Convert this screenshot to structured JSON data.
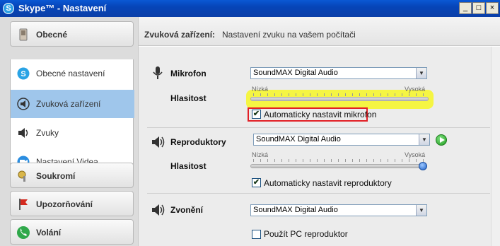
{
  "window": {
    "title": "Skype™ - Nastavení",
    "app_icon_glyph": "S"
  },
  "controls": {
    "minimize": "_",
    "maximize": "□",
    "close": "×"
  },
  "sidebar": {
    "categories": [
      {
        "label": "Obecné",
        "icon": "settings-switch-icon"
      },
      {
        "label": "Soukromí",
        "icon": "lock-key-icon"
      },
      {
        "label": "Upozorňování",
        "icon": "flag-icon"
      },
      {
        "label": "Volání",
        "icon": "phone-icon"
      }
    ],
    "items": [
      {
        "label": "Obecné nastavení",
        "icon": "skype-logo-icon"
      },
      {
        "label": "Zvuková zařízení",
        "icon": "audio-device-icon",
        "active": true
      },
      {
        "label": "Zvuky",
        "icon": "speaker-icon"
      },
      {
        "label": "Nastavení Videa",
        "icon": "video-camera-icon"
      }
    ]
  },
  "header": {
    "title": "Zvuková zařízení:",
    "subtitle": "Nastavení zvuku na vašem počítači"
  },
  "microphone": {
    "label": "Mikrofon",
    "device": "SoundMAX Digital Audio",
    "volume_label": "Hlasitost",
    "low": "Nízká",
    "high": "Vysoká",
    "auto_checked": true,
    "auto_label": "Automaticky nastavit mikrofon",
    "check_glyph": "✔"
  },
  "speakers": {
    "label": "Reproduktory",
    "device": "SoundMAX Digital Audio",
    "volume_label": "Hlasitost",
    "low": "Nízká",
    "high": "Vysoká",
    "level": 1.0,
    "auto_checked": true,
    "auto_label": "Automaticky nastavit reproduktory",
    "check_glyph": "✔"
  },
  "ringing": {
    "label": "Zvonění",
    "device": "SoundMAX Digital Audio",
    "pc_speaker_checked": false,
    "pc_speaker_label": "Použít PC reproduktor"
  },
  "colors": {
    "titlebar": "#0645b8",
    "active_item": "#9fc6eb",
    "highlight": "#f5f53a",
    "annotation": "#e21f26"
  }
}
